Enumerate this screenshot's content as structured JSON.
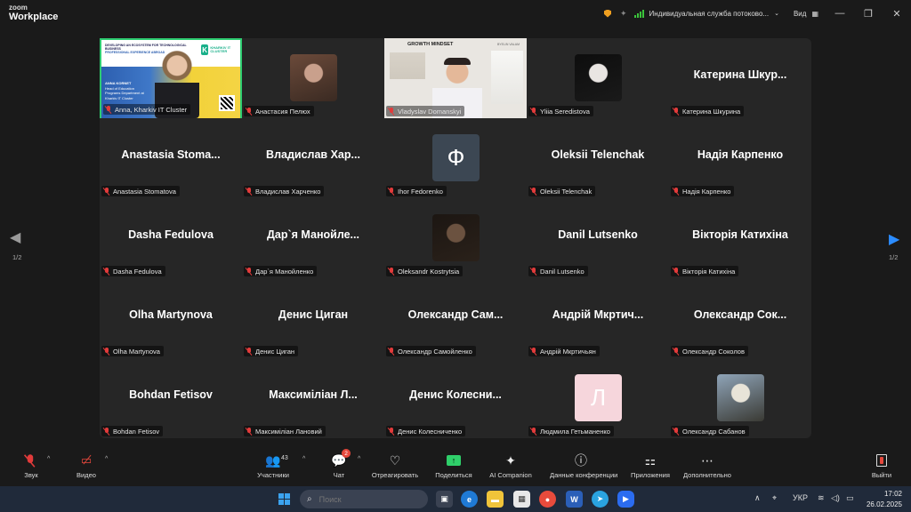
{
  "titlebar": {
    "logo_line1": "zoom",
    "logo_line2": "Workplace",
    "meeting_name": "Индивидуальная служба потоково...",
    "view_label": "Вид",
    "minimize": "—",
    "restore": "❐",
    "close": "✕"
  },
  "tiles": [
    {
      "type": "slide",
      "label": "Anna, Kharkiv IT Cluster",
      "slide": {
        "header": "DEVELOPING AN ECOSYSTEM FOR TECHNOLOGICAL BUSINESS",
        "sub": "PROFESSIONAL EXPERIENCE ABROAD",
        "brand_letter": "K",
        "brand_text": "KHARKIV IT CLUSTER",
        "speaker": "ANNA KORNET",
        "role": "Head of Education Programs Department at Kharkiv IT Cluster"
      }
    },
    {
      "type": "photo",
      "label": "Анастасия Пелюх",
      "photo_colors": [
        "#6b4a3a",
        "#c9a08c",
        "#3a2a22"
      ]
    },
    {
      "type": "growth",
      "label": "Vladyslav Domanskyi",
      "title": "GROWTH MINDSET",
      "brand": "BYELIN VALAM"
    },
    {
      "type": "photo",
      "label": "Yliia Seredistova",
      "photo_colors": [
        "#0d0d0d",
        "#e9e5e2",
        "#1a1a1a"
      ]
    },
    {
      "type": "name",
      "name": "Катерина  Шкур...",
      "label": "Катерина Шкурина"
    },
    {
      "type": "name",
      "name": "Anastasia  Stoma...",
      "label": "Anastasia Stomatova"
    },
    {
      "type": "name",
      "name": "Владислав  Хар...",
      "label": "Владислав Харченко"
    },
    {
      "type": "letter",
      "letter": "Ф",
      "bg": "#3c4753",
      "fg": "#ffffff",
      "label": "Ihor Fedorenko"
    },
    {
      "type": "name",
      "name": "Oleksii Telenchak",
      "label": "Oleksii Telenchak"
    },
    {
      "type": "name",
      "name": "Надія Карпенко",
      "label": "Надія Карпенко"
    },
    {
      "type": "name",
      "name": "Dasha Fedulova",
      "label": "Dasha Fedulova"
    },
    {
      "type": "name",
      "name": "Дар`я  Манойле...",
      "label": "Дар`я Манойленко"
    },
    {
      "type": "photo",
      "label": "Oleksandr Kostrytsia",
      "photo_colors": [
        "#1c1612",
        "#6b5240",
        "#2a211a"
      ]
    },
    {
      "type": "name",
      "name": "Danil Lutsenko",
      "label": "Danil Lutsenko"
    },
    {
      "type": "name",
      "name": "Вікторія Катихіна",
      "label": "Вікторія Катихіна"
    },
    {
      "type": "name",
      "name": "Olha Martynova",
      "label": "Olha Martynova"
    },
    {
      "type": "name",
      "name": "Денис Циган",
      "label": "Денис Циган"
    },
    {
      "type": "name",
      "name": "Олександр  Сам...",
      "label": "Олександр Самойленко"
    },
    {
      "type": "name",
      "name": "Андрій  Мкртич...",
      "label": "Андрій Мкртичьян"
    },
    {
      "type": "name",
      "name": "Олександр  Сок...",
      "label": "Олександр Соколов"
    },
    {
      "type": "name",
      "name": "Bohdan Fetisov",
      "label": "Bohdan Fetisov"
    },
    {
      "type": "name",
      "name": "Максиміліан  Л...",
      "label": "Максиміліан Лановий"
    },
    {
      "type": "name",
      "name": "Денис  Колесни...",
      "label": "Денис Колесниченко"
    },
    {
      "type": "letter",
      "letter": "Л",
      "bg": "#f6d6dc",
      "fg": "#ffffff",
      "label": "Людмила Гетьманенко"
    },
    {
      "type": "photo",
      "label": "Олександр Сабанов",
      "photo_colors": [
        "#8fa4b8",
        "#e8e4d8",
        "#3a3a34"
      ]
    }
  ],
  "pager": {
    "left": "1/2",
    "right": "1/2",
    "left_arrow": "◀",
    "right_arrow": "▶",
    "left_color": "#9a9a9a",
    "right_color": "#2b8cff"
  },
  "toolbar": {
    "audio": {
      "label": "Звук",
      "icon": "mic-off-icon"
    },
    "video": {
      "label": "Видео",
      "icon": "video-off-icon"
    },
    "participants": {
      "label": "Участники",
      "count": "43"
    },
    "chat": {
      "label": "Чат",
      "badge": "2"
    },
    "react": {
      "label": "Отреагировать"
    },
    "share": {
      "label": "Поделиться"
    },
    "ai": {
      "label": "AI Companion"
    },
    "info": {
      "label": "Данные конференции"
    },
    "apps": {
      "label": "Приложения"
    },
    "more": {
      "label": "Дополнительно"
    },
    "leave": {
      "label": "Выйти"
    },
    "caret": "^"
  },
  "taskbar": {
    "search_placeholder": "Поиск",
    "lang": "УКР",
    "time": "17:02",
    "date": "26.02.2025"
  }
}
